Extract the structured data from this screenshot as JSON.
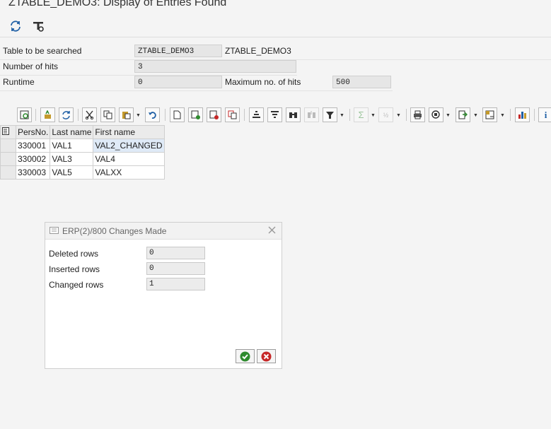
{
  "window": {
    "title": "ZTABLE_DEMO3: Display of Entries Found"
  },
  "app_toolbar": {
    "icons": [
      "refresh-icon",
      "settings-icon"
    ]
  },
  "fields": {
    "table": {
      "label": "Table to be searched",
      "value": "ZTABLE_DEMO3",
      "description": "ZTABLE_DEMO3"
    },
    "hits": {
      "label": "Number of hits",
      "value": "3"
    },
    "runtime": {
      "label": "Runtime",
      "value": "0"
    },
    "max_hits": {
      "label": "Maximum no. of hits",
      "value": "500"
    }
  },
  "grid": {
    "columns": [
      "PersNo.",
      "Last name",
      "First name"
    ],
    "rows": [
      {
        "persno": "330001",
        "last": "VAL1",
        "first": "VAL2_CHANGED"
      },
      {
        "persno": "330002",
        "last": "VAL3",
        "first": "VAL4"
      },
      {
        "persno": "330003",
        "last": "VAL5",
        "first": "VALXX"
      }
    ]
  },
  "dialog": {
    "title": "ERP(2)/800 Changes Made",
    "deleted": {
      "label": "Deleted rows",
      "value": "0"
    },
    "inserted": {
      "label": "Inserted rows",
      "value": "0"
    },
    "changed": {
      "label": "Changed rows",
      "value": "1"
    }
  },
  "colors": {
    "confirm": "#2e8b2e",
    "cancel": "#c62828",
    "highlight": "#dfeaf7"
  }
}
